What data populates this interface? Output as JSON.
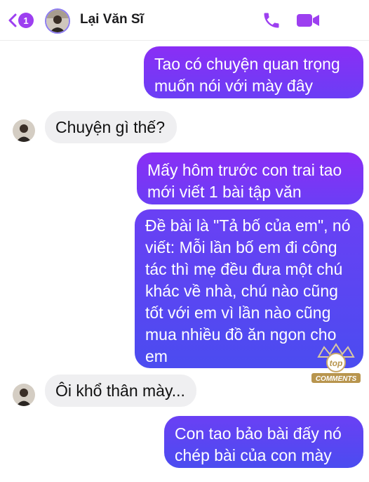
{
  "header": {
    "back_badge": "1",
    "contact_name": "Lại Văn Sĩ"
  },
  "messages": [
    {
      "side": "out",
      "text_lines": [
        "Tao có chuyện quan trọng",
        "muốn nói với mày đây"
      ]
    },
    {
      "side": "in",
      "text": "Chuyện gì thế?"
    },
    {
      "side": "out",
      "text_lines": [
        "Mấy hôm trước con trai tao",
        "mới viết 1 bài tập văn"
      ]
    },
    {
      "side": "out",
      "text_lines": [
        "Đề bài là \"Tả bố của em\", nó",
        "viết: Mỗi lần bố em đi công",
        "tác thì mẹ đều đưa một chú",
        "khác về nhà, chú nào cũng",
        "tốt với em vì lần nào cũng",
        "mua nhiều đồ ăn ngon cho",
        "em"
      ]
    },
    {
      "side": "in",
      "text": "Ôi khổ thân mày..."
    },
    {
      "side": "out",
      "text_lines": [
        "Con tao bảo bài đấy nó",
        "chép bài của con mày"
      ]
    }
  ],
  "watermark": {
    "top": "top",
    "bottom": "COMMENTS"
  },
  "colors": {
    "accent": "#9d3ff0",
    "bubble_out_top": "#8a2ef5",
    "bubble_out_bottom": "#4b4cf0",
    "bubble_in": "#efeff1"
  },
  "icons": [
    "chevron-left-icon",
    "phone-icon",
    "video-camera-icon"
  ]
}
